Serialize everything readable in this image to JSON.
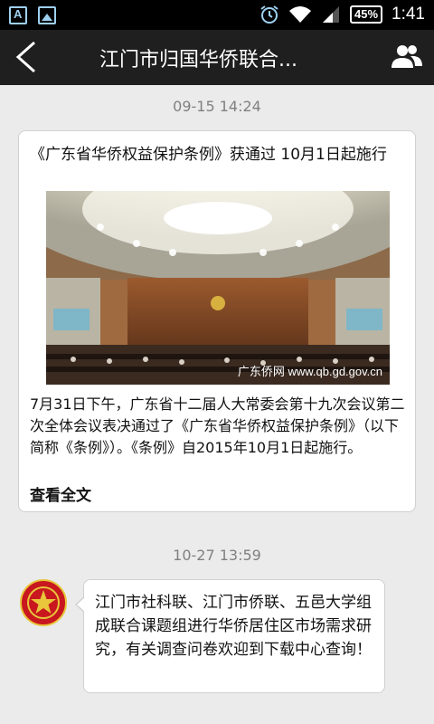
{
  "status_bar": {
    "battery": "45%",
    "time": "1:41"
  },
  "header": {
    "title": "江门市归国华侨联合..."
  },
  "feed": [
    {
      "timestamp": "09-15 14:24",
      "title": "《广东省华侨权益保护条例》获通过 10月1日起施行",
      "image_watermark": "广东侨网 www.qb.gd.gov.cn",
      "summary": " 7月31日下午，广东省十二届人大常委会第十九次会议第二次全体会议表决通过了《广东省华侨权益保护条例》（以下简称《条例》）。《条例》自2015年10月1日起施行。",
      "read_more": "查看全文"
    },
    {
      "timestamp": "10-27 13:59",
      "message": "江门市社科联、江门市侨联、五邑大学组成联合课题组进行华侨居住区市场需求研究，有关调查问卷欢迎到下载中心查询！"
    }
  ],
  "colors": {
    "title_bar": "#1f1f1f",
    "background": "#ebebeb",
    "avatar_red": "#c8171e"
  }
}
